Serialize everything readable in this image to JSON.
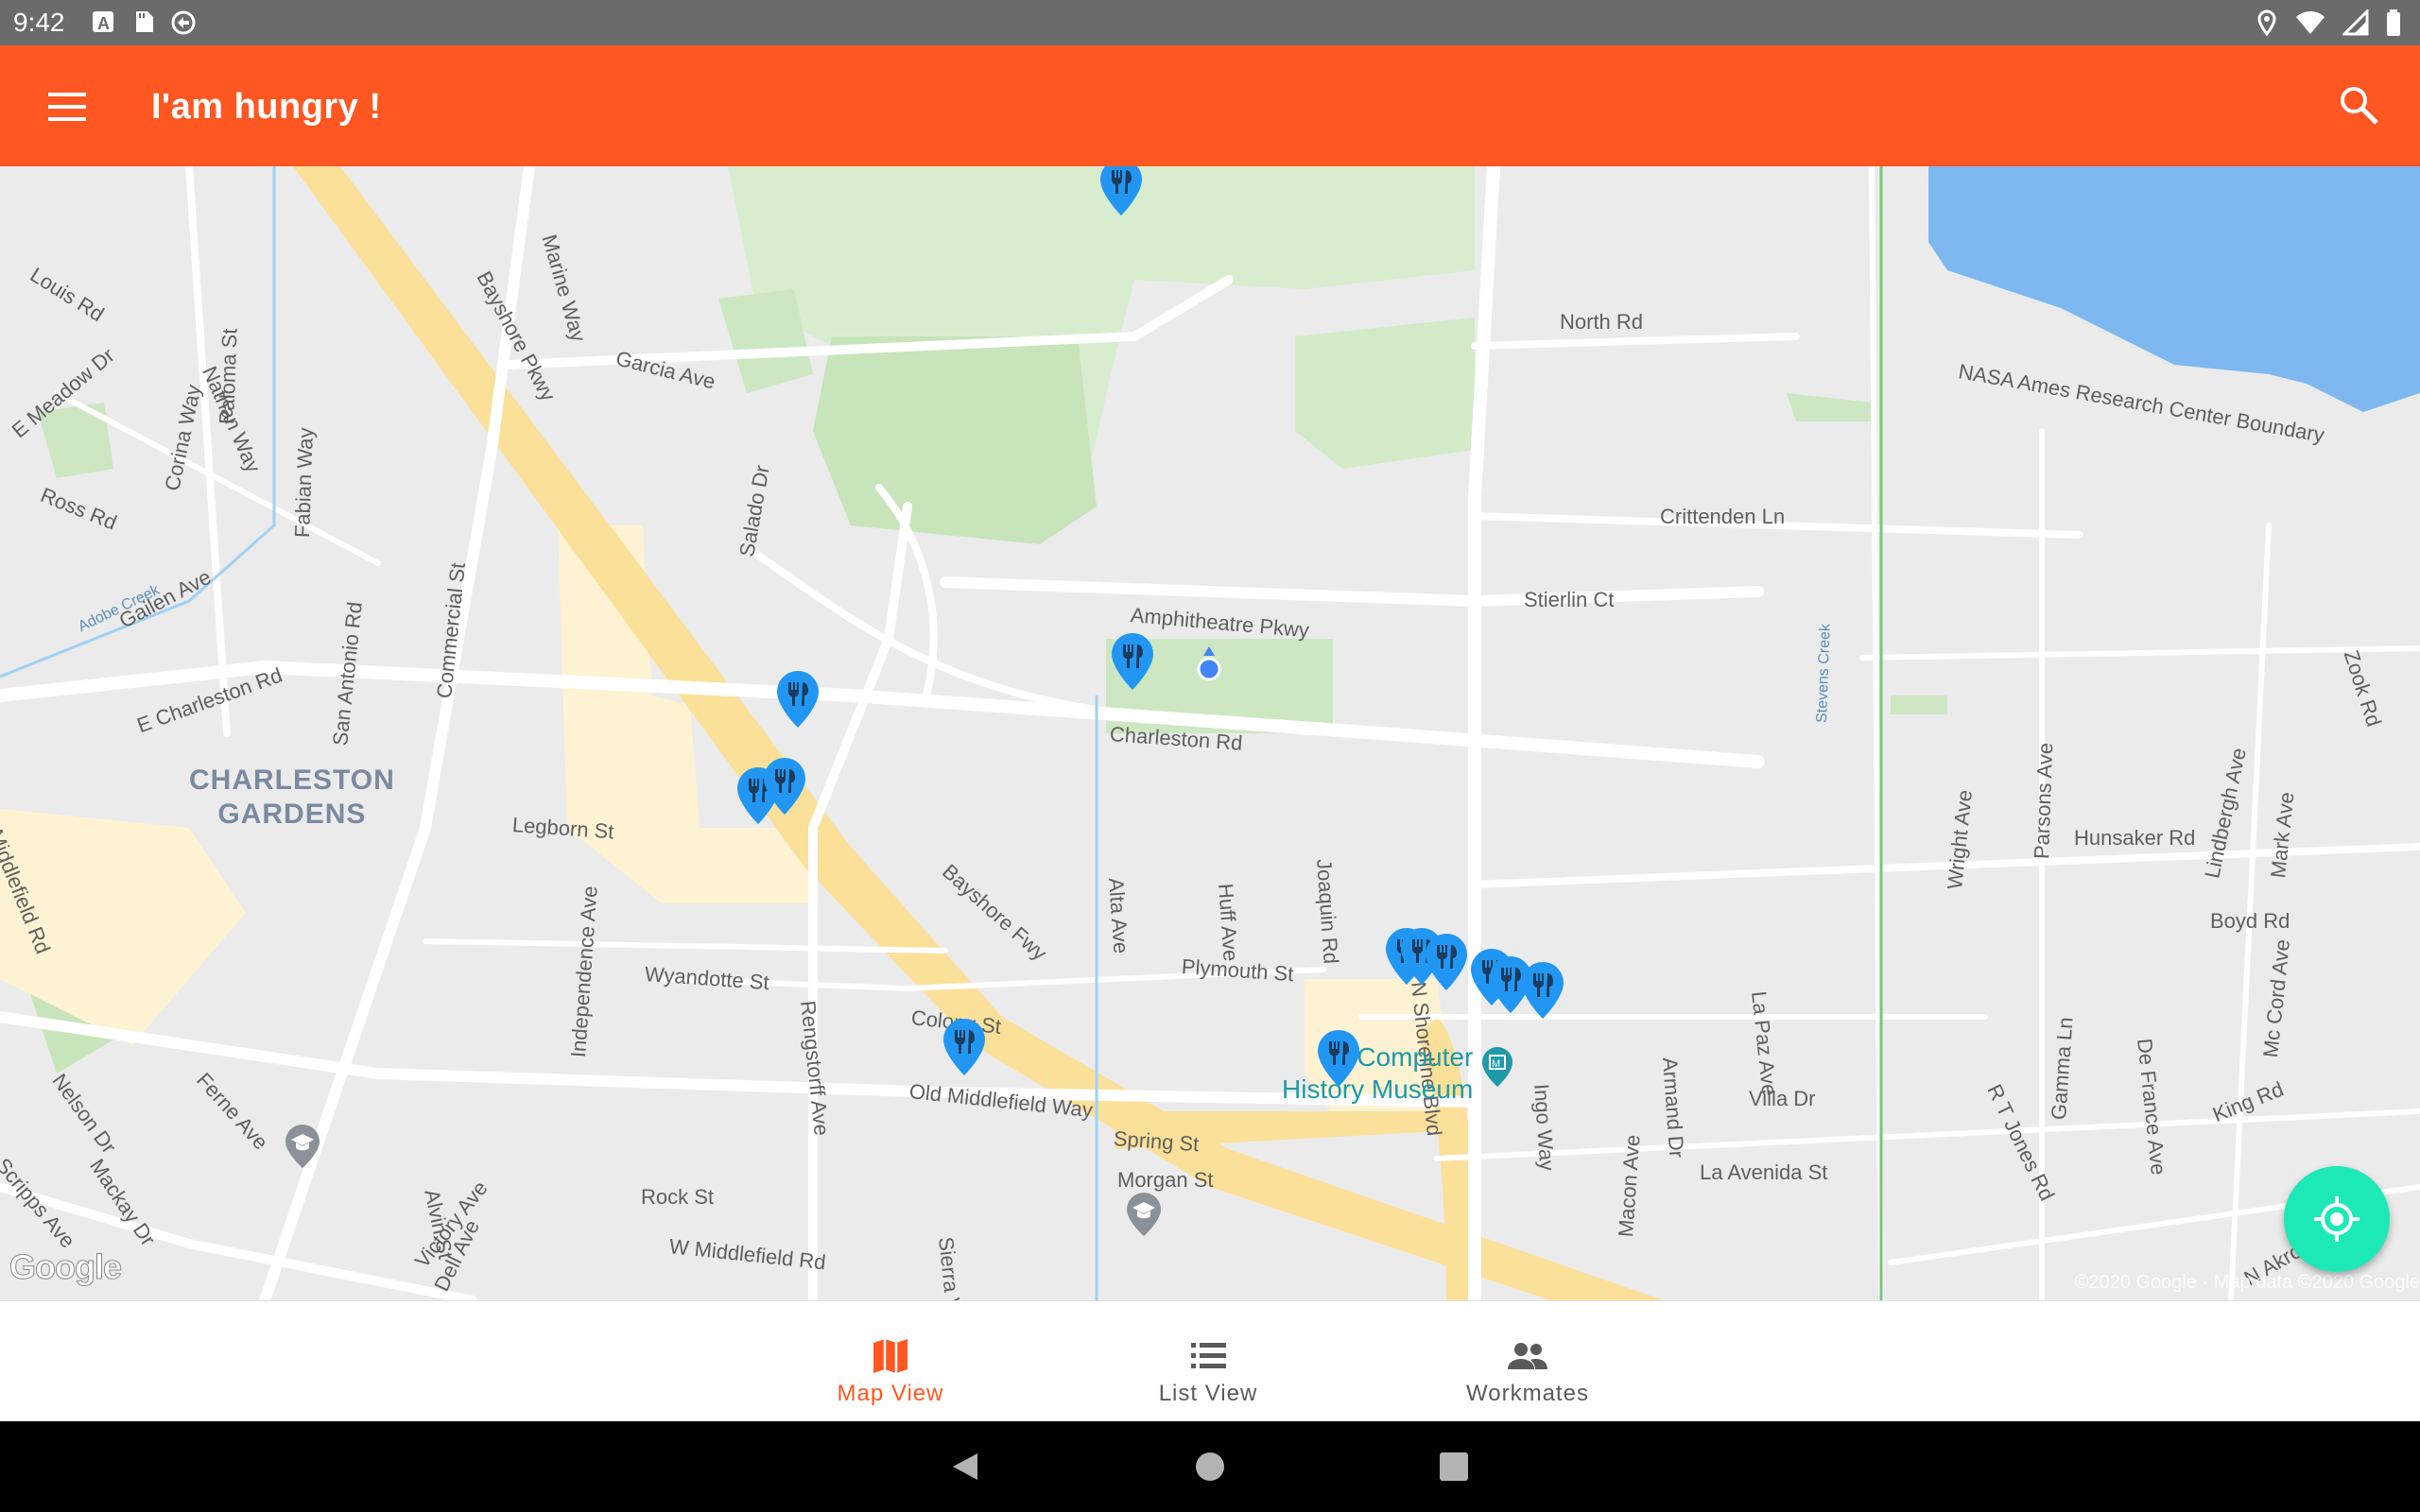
{
  "status_bar": {
    "time": "9:42",
    "left_icons": [
      "a-letter-icon",
      "sd-card-icon",
      "sync-icon"
    ],
    "right_icons": [
      "location-icon",
      "wifi-icon",
      "cell-signal-icon",
      "battery-icon"
    ]
  },
  "app_bar": {
    "title": "I'am hungry !",
    "background": "#ff5722",
    "menu_icon": "menu-icon",
    "search_icon": "search-icon"
  },
  "map": {
    "area_label": "CHARLESTON\nGARDENS",
    "poi": "Computer\nHistory Museum",
    "streets": [
      "Louis Rd",
      "Paloma St",
      "Marine Way",
      "Bayshore Pkwy",
      "Fabian Way",
      "Garcia Ave",
      "E Meadow Dr",
      "Nathan Way",
      "Corina Way",
      "Ross Rd",
      "North Rd",
      "NASA Ames Research Center Boundary",
      "Crittenden Ln",
      "Commercial St",
      "Salado Dr",
      "Amphitheatre Pkwy",
      "Stierlin Ct",
      "Adobe Creek",
      "Gailen Ave",
      "E Charleston Rd",
      "San Antonio Rd",
      "Middlefield Rd",
      "Charleston Rd",
      "Stevens Creek",
      "Zook Rd",
      "Parsons Ave",
      "Lindbergh Ave",
      "Legborn St",
      "Hunsaker Rd",
      "Wright Ave",
      "Bayshore Fwy",
      "Alta Ave",
      "Huff Ave",
      "Joaquin Rd",
      "Mark Ave",
      "Boyd Rd",
      "Wyandotte St",
      "Rengstorff Ave",
      "Plymouth St",
      "Independence Ave",
      "N Shoreline Blvd",
      "La Paz Ave",
      "De France Ave",
      "Mc Cord Ave",
      "Colony St",
      "Armand Dr",
      "Ingo Way",
      "R T Jones Rd",
      "Gamma Ln",
      "Nelson Dr",
      "Ferne Ave",
      "Old Middlefield Way",
      "Villa Dr",
      "King Rd",
      "Spring St",
      "Scripps Ave",
      "Mackay Dr",
      "Alvin St",
      "La Avenida St",
      "Rock St",
      "Morgan St",
      "Victory Ave",
      "Macon Ave",
      "W Middlefield Rd",
      "Sierra Vista Ave",
      "Dell Ave",
      "N Akron Rd"
    ],
    "google_logo": "Google",
    "copyright": "©2020 Google · Map data ©2020 Google",
    "restaurant_marker_count": 12,
    "restaurant_marker_color": "#2196f3"
  },
  "fab": {
    "icon": "my-location-icon",
    "color": "#1de9b6"
  },
  "bottom_nav": {
    "items": [
      {
        "label": "Map View",
        "icon": "map-icon",
        "active": true
      },
      {
        "label": "List View",
        "icon": "list-icon",
        "active": false
      },
      {
        "label": "Workmates",
        "icon": "people-icon",
        "active": false
      }
    ],
    "active_color": "#ff5722"
  },
  "system_nav": {
    "icons": [
      "back-icon",
      "home-icon",
      "recents-icon"
    ]
  }
}
